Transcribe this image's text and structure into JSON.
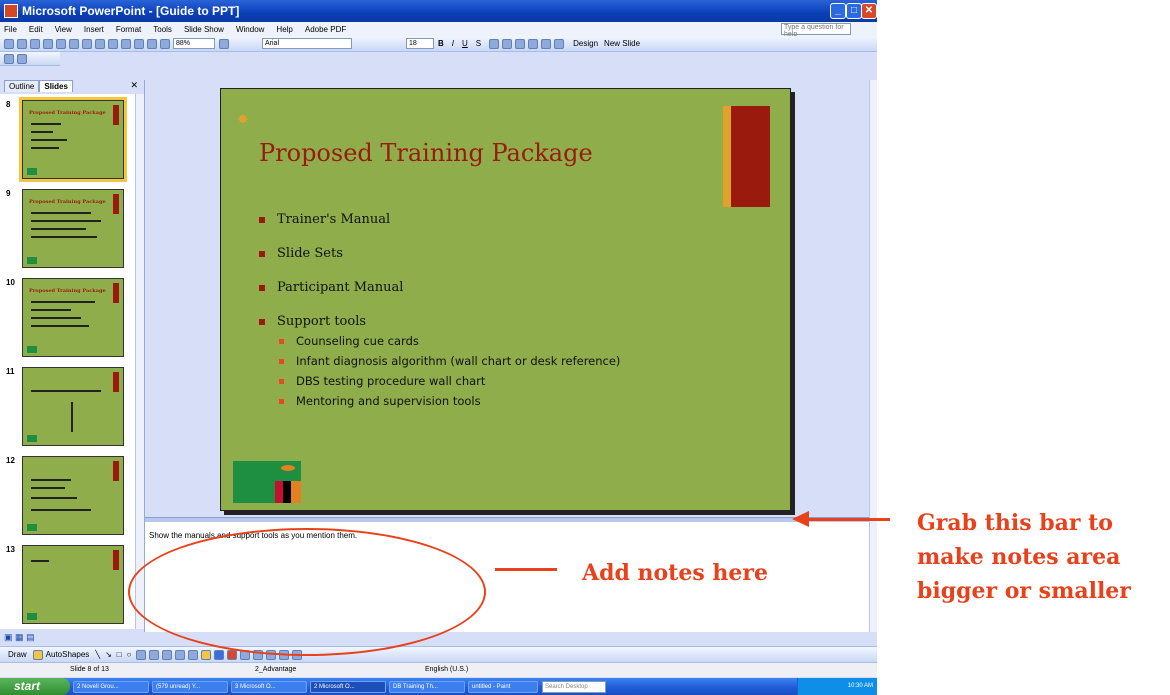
{
  "window": {
    "title": "Microsoft PowerPoint - [Guide to PPT]"
  },
  "menu": {
    "items": [
      "File",
      "Edit",
      "View",
      "Insert",
      "Format",
      "Tools",
      "Slide Show",
      "Window",
      "Help",
      "Adobe PDF"
    ],
    "help_placeholder": "Type a question for help"
  },
  "toolbar": {
    "zoom": "88%",
    "font": "Arial",
    "font_size": "18",
    "design_label": "Design",
    "new_slide_label": "New Slide"
  },
  "left_pane": {
    "tabs": [
      "Outline",
      "Slides"
    ],
    "thumbnails": [
      {
        "num": "8",
        "title": "Proposed Training Package"
      },
      {
        "num": "9",
        "title": "Proposed Training Package"
      },
      {
        "num": "10",
        "title": "Proposed Training Package"
      },
      {
        "num": "11",
        "title": ""
      },
      {
        "num": "12",
        "title": ""
      },
      {
        "num": "13",
        "title": ""
      }
    ]
  },
  "slide": {
    "title": "Proposed Training Package",
    "bullets": [
      "Trainer's Manual",
      "Slide Sets",
      "Participant Manual",
      "Support tools"
    ],
    "sub_bullets": [
      "Counseling cue cards",
      "Infant diagnosis algorithm (wall chart or desk reference)",
      "DBS testing procedure wall chart",
      "Mentoring and supervision tools"
    ]
  },
  "notes": {
    "text": "Show the manuals and support tools as you mention them."
  },
  "drawbar": {
    "draw_label": "Draw",
    "autoshapes_label": "AutoShapes"
  },
  "status": {
    "slide_of": "Slide 8 of 13",
    "design": "2_Advantage",
    "language": "English (U.S.)"
  },
  "taskbar": {
    "start_label": "start",
    "tasks": [
      "2 Novell Grou...",
      "(579 unread) Y...",
      "3 Microsoft O...",
      "2 Microsoft O...",
      "DB Training Th...",
      "untitled - Paint"
    ],
    "search_placeholder": "Search Desktop",
    "clock": "10:30 AM"
  },
  "annotations": {
    "notes_label": "Add notes here",
    "bar_label": "Grab this bar to make notes area bigger or smaller"
  },
  "colors": {
    "slide_bg": "#8fad4b",
    "slide_accent": "#9a1b0e",
    "annotation": "#e8411b"
  }
}
